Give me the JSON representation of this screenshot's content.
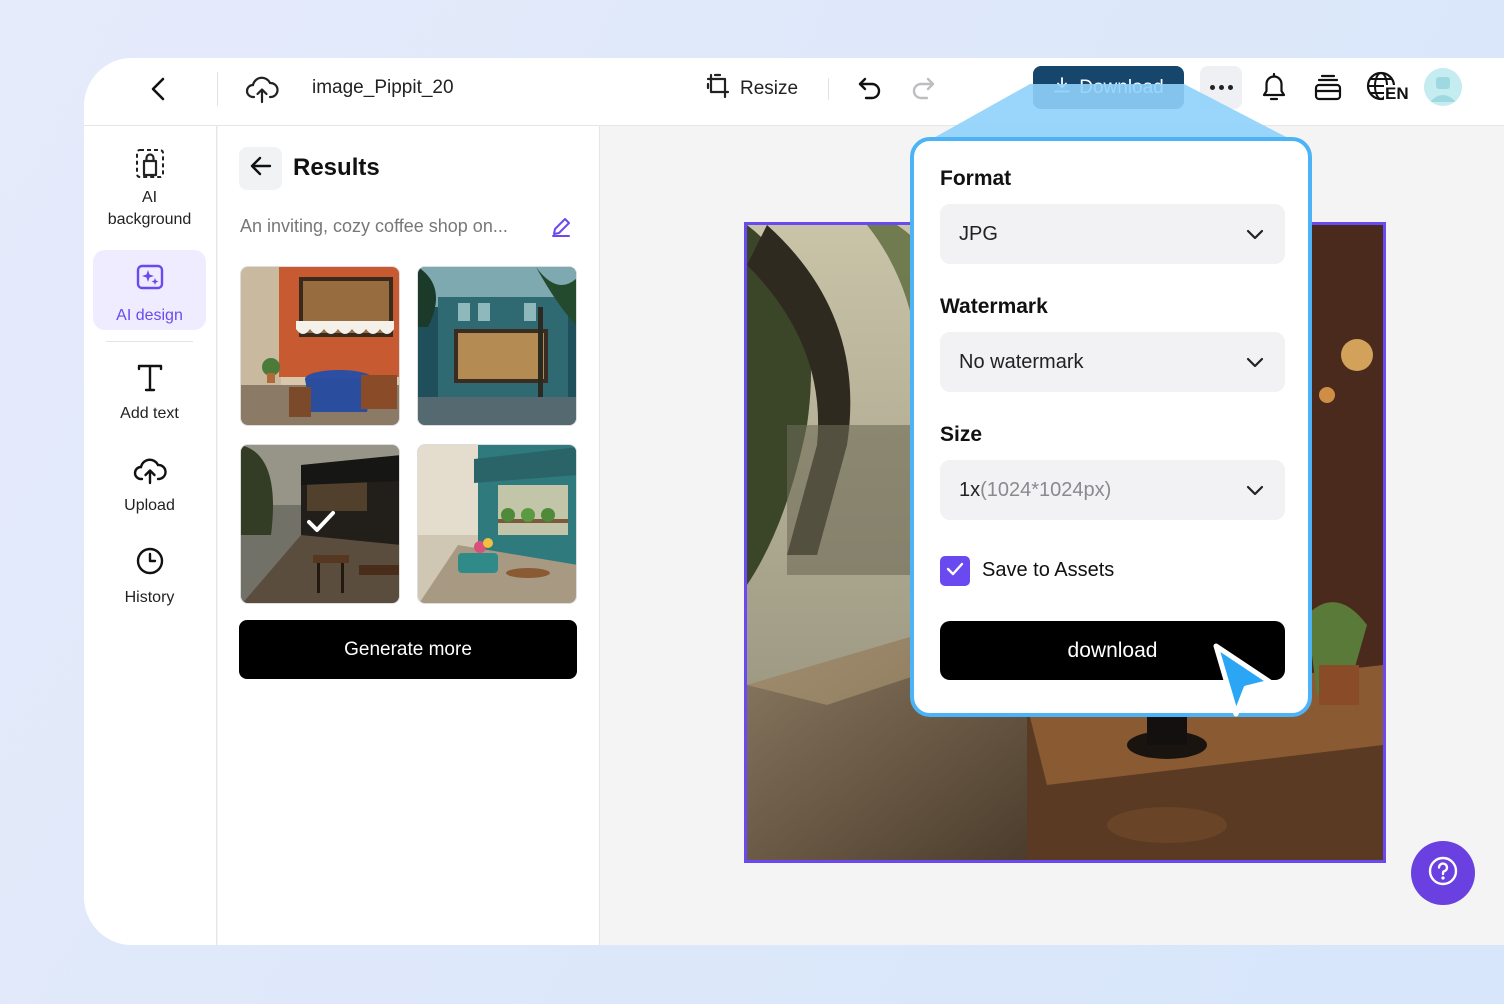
{
  "topbar": {
    "back_icon": "chevron-left-icon",
    "cloud_icon": "cloud-sync-icon",
    "filename": "image_Pippit_20",
    "resize_label": "Resize",
    "undo_icon": "undo-icon",
    "redo_icon": "redo-icon",
    "download_label": "Download",
    "more_icon": "more-dots-icon",
    "bell_icon": "bell-icon",
    "stack_icon": "layers-icon",
    "language_icon": "globe-icon",
    "language_code": "EN",
    "accent_color": "#16466c"
  },
  "sidebar": {
    "items": [
      {
        "label": "AI background",
        "icon": "ai-background-icon"
      },
      {
        "label": "AI design",
        "icon": "ai-design-icon",
        "active": true
      },
      {
        "label": "Add text",
        "icon": "text-icon"
      },
      {
        "label": "Upload",
        "icon": "upload-icon"
      },
      {
        "label": "History",
        "icon": "clock-icon"
      }
    ],
    "active_color": "#6a4af0"
  },
  "panel": {
    "title": "Results",
    "prompt": "An inviting, cozy coffee shop on...",
    "generate_more_label": "Generate more",
    "thumbnails": [
      {
        "name": "cafe-result-1",
        "selected": false
      },
      {
        "name": "cafe-result-2",
        "selected": false
      },
      {
        "name": "cafe-result-3",
        "selected": true
      },
      {
        "name": "cafe-result-4",
        "selected": false
      }
    ]
  },
  "download_popup": {
    "format_label": "Format",
    "format_value": "JPG",
    "watermark_label": "Watermark",
    "watermark_value": "No watermark",
    "size_label": "Size",
    "size_value_prefix": "1x",
    "size_value_detail": "(1024*1024px)",
    "save_to_assets_label": "Save to Assets",
    "save_to_assets_checked": true,
    "download_label": "download",
    "border_color": "#4db3f7"
  },
  "help_icon": "help-circle-icon"
}
